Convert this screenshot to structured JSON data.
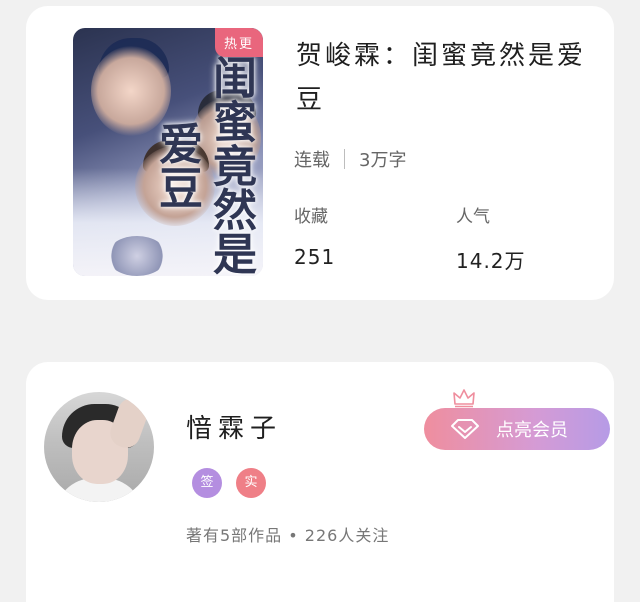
{
  "book": {
    "cover_badge": "热更",
    "cover_art_text": "闺蜜竟然是爱豆",
    "title": "贺峻霖：闺蜜竟然是爱豆",
    "status": "连载",
    "word_count": "3万字",
    "favorites_label": "收藏",
    "favorites_value": "251",
    "popularity_label": "人气",
    "popularity_value": "14.2万"
  },
  "author": {
    "name": "愔霖子",
    "badge_signed": "签",
    "badge_verified": "实",
    "meta": "著有5部作品 • 226人关注"
  },
  "membership": {
    "button_label": "点亮会员",
    "icon": "diamond-icon",
    "decoration": "crown-icon"
  },
  "colors": {
    "background": "#f1f1f1",
    "card": "#ffffff",
    "hot_badge": "#e9667d",
    "badge_signed": "#b48ee0",
    "badge_verified": "#ef7f87",
    "member_gradient_start": "#ef8e9e",
    "member_gradient_end": "#b69be6"
  }
}
